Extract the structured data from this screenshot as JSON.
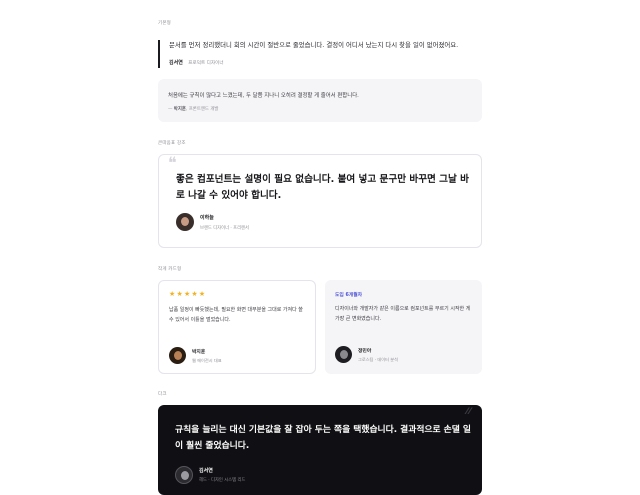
{
  "basic": {
    "label": "기본형",
    "quote": "문서를 먼저 정리했더니 회의 시간이 절반으로 줄었습니다. 결정이 어디서 났는지 다시 찾을 일이 없어졌어요.",
    "author_name": "김서연",
    "author_role": "프로덕트 디자이너",
    "note": "처음에는 규칙이 많다고 느꼈는데, 두 달쯤 지나니 오히려 결정할 게 줄어서 편합니다.",
    "note_author_name": "박지훈",
    "note_author_role": "프론트엔드 개발",
    "note_dash": "—"
  },
  "featured": {
    "label": "큰따옴표 강조",
    "quote_mark": "❝",
    "quote": "좋은 컴포넌트는 설명이 필요 없습니다. 붙여 넣고 문구만 바꾸면 그날 바로 나갈 수 있어야 합니다.",
    "author_name": "이하늘",
    "author_role": "브랜드 디자이너 · 프리랜서"
  },
  "cards": {
    "label": "작게 카드형",
    "card1": {
      "stars": "★★★★★",
      "text": "납품 일정이 빠듯했는데, 필요한 화면 대부분을 그대로 가져다 쓸 수 있어서 이틀을 벌었습니다.",
      "author_name": "박지훈",
      "author_role": "웹 에이전시 대표"
    },
    "card2": {
      "tag": "도입 6개월차",
      "text": "디자이너와 개발자가 같은 이름으로 컴포넌트를 부르기 시작한 게 가장 큰 변화였습니다.",
      "author_name": "정민아",
      "author_role": "그로스팀 · 데이터 분석"
    }
  },
  "dark": {
    "label": "다크",
    "quote": "규칙을 늘리는 대신 기본값을 잘 잡아 두는 쪽을 택했습니다. 결과적으로 손댈 일이 훨씬 줄었습니다.",
    "author_name": "김서연",
    "author_role": "헤드 · 디자인 시스템 리드"
  }
}
